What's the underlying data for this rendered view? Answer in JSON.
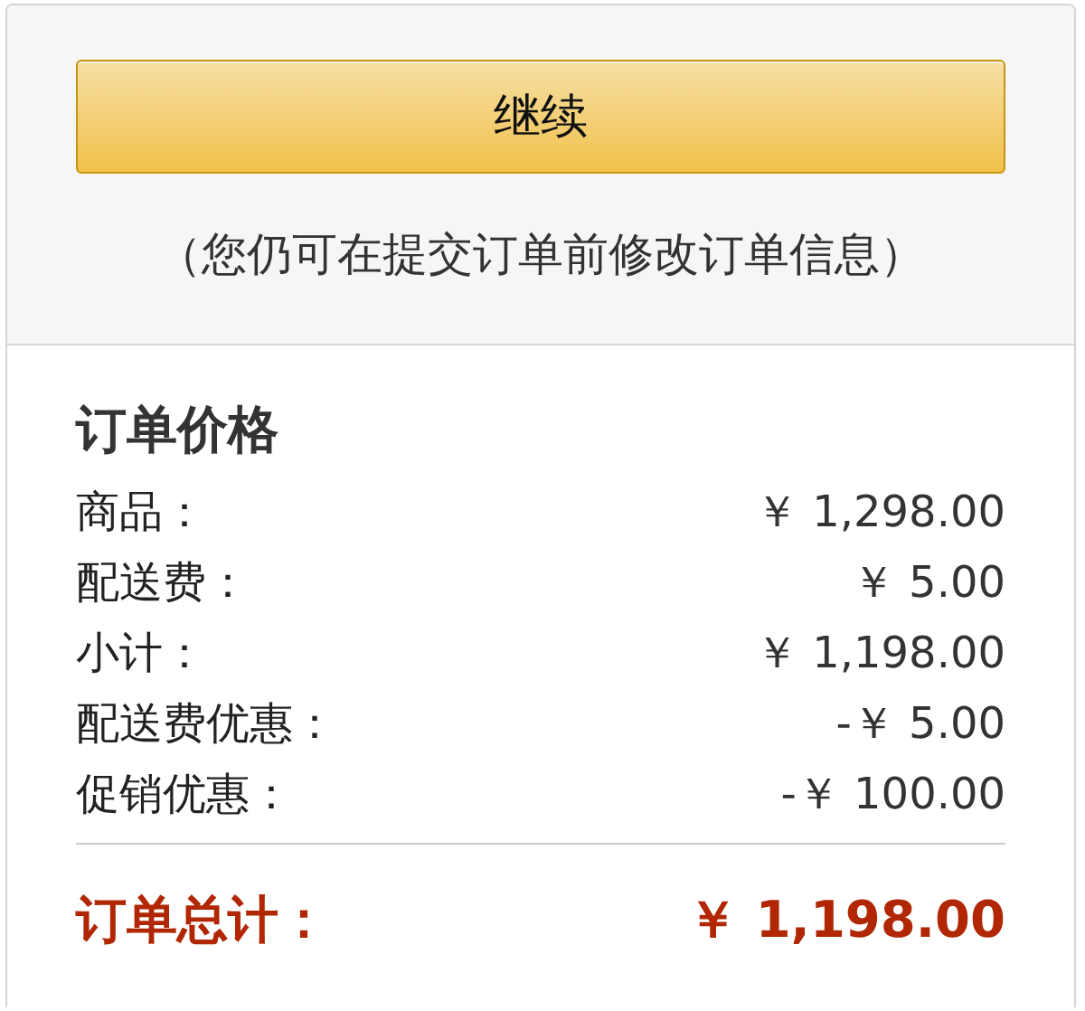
{
  "continue_button": {
    "label": "继续"
  },
  "note": "（您仍可在提交订单前修改订单信息）",
  "order_summary": {
    "title": "订单价格",
    "rows": [
      {
        "label": "商品：",
        "amount": "￥ 1,298.00"
      },
      {
        "label": "配送费：",
        "amount": "￥ 5.00"
      },
      {
        "label": "小计：",
        "amount": "￥ 1,198.00"
      },
      {
        "label": "配送费优惠：",
        "amount": "-￥ 5.00"
      },
      {
        "label": "促销优惠：",
        "amount": "-￥ 100.00"
      }
    ],
    "total": {
      "label": "订单总计：",
      "amount": "￥ 1,198.00"
    }
  }
}
